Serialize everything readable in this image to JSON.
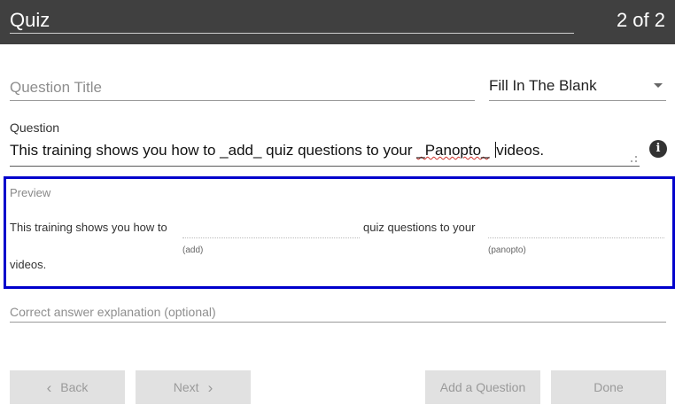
{
  "header": {
    "title": "Quiz",
    "counter": "2 of 2"
  },
  "question_title": {
    "placeholder": "Question Title",
    "value": ""
  },
  "question_type": {
    "selected": "Fill In The Blank"
  },
  "question": {
    "label": "Question",
    "text_before": "This training shows you how to _add_ quiz questions to your ",
    "text_squiggle": "_Panopto_",
    "text_after": "videos."
  },
  "preview": {
    "label": "Preview",
    "segment1": "This training shows you how to",
    "segment2": "quiz questions to your",
    "segment3": "videos.",
    "blank1_hint": "(add)",
    "blank2_hint": "(panopto)"
  },
  "explanation": {
    "placeholder": "Correct answer explanation (optional)",
    "value": ""
  },
  "buttons": {
    "back": "Back",
    "next": "Next",
    "add": "Add a Question",
    "done": "Done"
  },
  "icons": {
    "info": "info-icon",
    "dropdown": "chevron-down-icon",
    "back": "chevron-left-icon",
    "next": "chevron-right-icon"
  },
  "colors": {
    "header_bg": "#404040",
    "preview_border": "#0000cc",
    "button_bg": "#e1e1e1"
  }
}
